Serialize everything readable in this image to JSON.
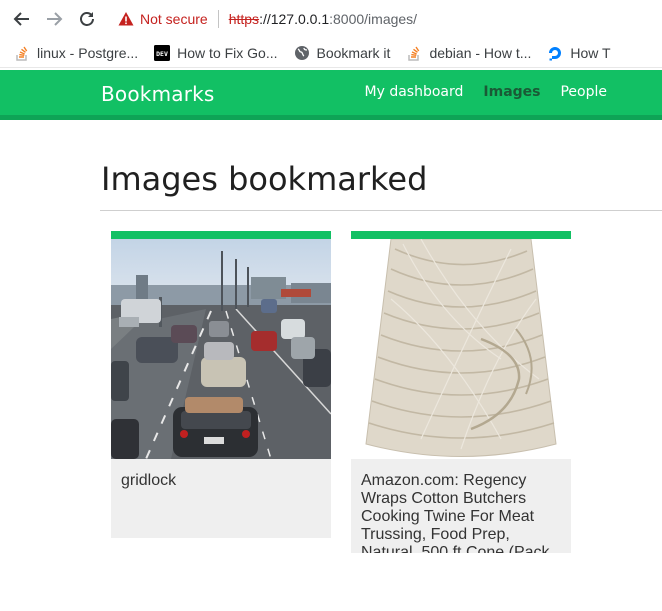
{
  "browser": {
    "security_label": "Not secure",
    "url_scheme": "https",
    "url_host": "://127.0.0.1",
    "url_rest": ":8000/images/"
  },
  "bookmarks": [
    {
      "label": "linux - Postgre...",
      "icon": "stackoverflow-icon"
    },
    {
      "label": "How to Fix Go...",
      "icon": "dev-icon"
    },
    {
      "label": "Bookmark it",
      "icon": "globe-icon"
    },
    {
      "label": "debian - How t...",
      "icon": "stackoverflow-icon"
    },
    {
      "label": "How T",
      "icon": "digitalocean-icon"
    }
  ],
  "header": {
    "logo": "Bookmarks",
    "menu": [
      {
        "label": "My dashboard",
        "active": false
      },
      {
        "label": "Images",
        "active": true
      },
      {
        "label": "People",
        "active": false
      }
    ]
  },
  "main": {
    "title": "Images bookmarked",
    "images": [
      {
        "title": "gridlock",
        "picture": "traffic jam on highway"
      },
      {
        "title": "Amazon.com: Regency Wraps Cotton Butchers Cooking Twine For Meat Trussing, Food Prep, Natural, 500 ft Cone (Pack",
        "picture": "cone of cotton twine"
      }
    ]
  },
  "colors": {
    "accent": "#12c064",
    "accent_dark": "#0ea456",
    "active_menu": "#1a5a36",
    "warning": "#c5221f"
  }
}
